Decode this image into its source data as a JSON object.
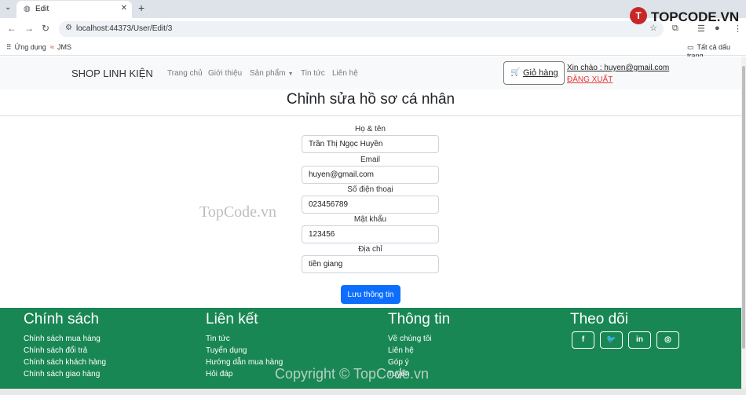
{
  "browser": {
    "tab_title": "Edit",
    "new_tab": "+",
    "url": "localhost:44373/User/Edit/3",
    "bookmarks": [
      {
        "label": "Ứng dụng"
      },
      {
        "label": "JMS"
      }
    ],
    "all_bookmarks": "Tất cả dấu trang"
  },
  "logo": {
    "mark": "T",
    "text": "TOPCODE.VN"
  },
  "navbar": {
    "brand": "SHOP LINH KIỆN",
    "links": [
      "Trang chủ",
      "Giới thiệu",
      "Sản phẩm",
      "Tin tức",
      "Liên hệ"
    ],
    "cart_label": "Giỏ hàng",
    "greeting": "Xin chào : huyen@gmail.com",
    "logout": "ĐĂNG XUẤT"
  },
  "form": {
    "title": "Chỉnh sửa hồ sơ cá nhân",
    "fields": [
      {
        "label": "Họ & tên",
        "value": "Trần Thị Ngọc Huyền"
      },
      {
        "label": "Email",
        "value": "huyen@gmail.com"
      },
      {
        "label": "Số điện thoại",
        "value": "023456789"
      },
      {
        "label": "Mật khẩu",
        "value": "123456"
      },
      {
        "label": "Địa chỉ",
        "value": "tiền giang"
      }
    ],
    "submit": "Lưu thông tin"
  },
  "watermarks": {
    "middle": "TopCode.vn",
    "footer": "Copyright © TopCode.vn"
  },
  "footer": {
    "columns": [
      {
        "heading": "Chính sách",
        "links": [
          "Chính sách mua hàng",
          "Chính sách đổi trả",
          "Chính sách khách hàng",
          "Chính sách giao hàng"
        ]
      },
      {
        "heading": "Liên kết",
        "links": [
          "Tin tức",
          "Tuyển dụng",
          "Hướng dẫn mua hàng",
          "Hỏi đáp"
        ]
      },
      {
        "heading": "Thông tin",
        "links": [
          "Về chúng tôi",
          "Liên hệ",
          "Góp ý",
          "Tuyển"
        ]
      },
      {
        "heading": "Theo dõi",
        "social": [
          "facebook-icon",
          "twitter-icon",
          "linkedin-icon",
          "dribbble-icon"
        ]
      }
    ]
  },
  "colors": {
    "primary": "#0d6efd",
    "footer_bg": "#198754",
    "logout": "#e53935"
  }
}
